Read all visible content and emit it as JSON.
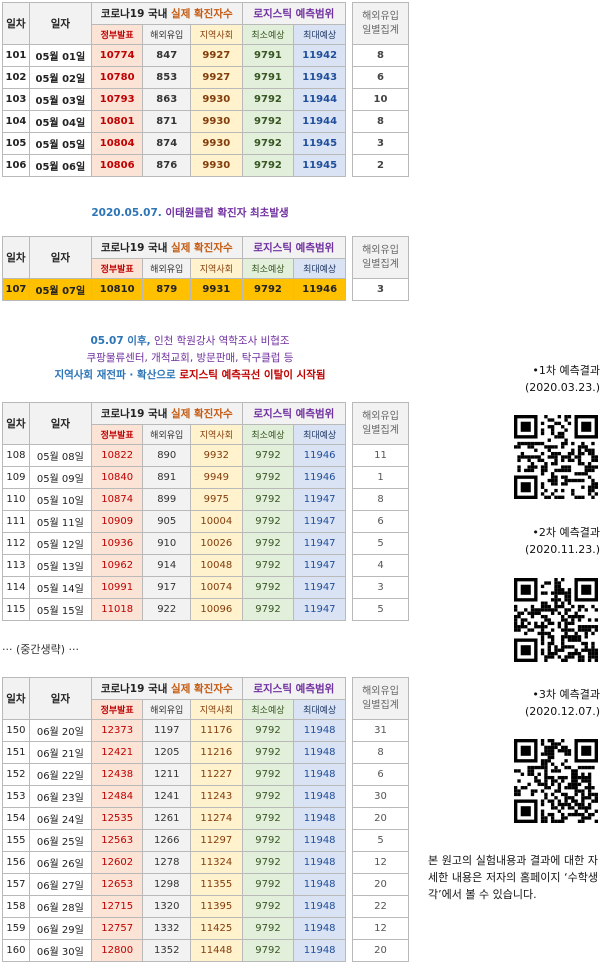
{
  "header": {
    "col_no": "일차",
    "col_date": "일자",
    "corona_title_a": "코로나19 국내 ",
    "corona_title_b": "실제 확진자수",
    "logistic_title_a": "로지스틱 ",
    "logistic_title_b": "예측범위",
    "sub_confirmed": "정부발표",
    "sub_overseas": "해외유입",
    "sub_local": "지역사회",
    "sub_min": "최소예상",
    "sub_max": "최대예상",
    "side_title_line1": "해외유입",
    "side_title_line2": "일별집계"
  },
  "table1": {
    "rows": [
      {
        "no": "101",
        "date": "05월 01일",
        "confirmed": "10774",
        "overseas": "847",
        "local": "9927",
        "min": "9791",
        "max": "11942",
        "daily": "8"
      },
      {
        "no": "102",
        "date": "05월 02일",
        "confirmed": "10780",
        "overseas": "853",
        "local": "9927",
        "min": "9791",
        "max": "11943",
        "daily": "6"
      },
      {
        "no": "103",
        "date": "05월 03일",
        "confirmed": "10793",
        "overseas": "863",
        "local": "9930",
        "min": "9792",
        "max": "11944",
        "daily": "10"
      },
      {
        "no": "104",
        "date": "05월 04일",
        "confirmed": "10801",
        "overseas": "871",
        "local": "9930",
        "min": "9792",
        "max": "11944",
        "daily": "8"
      },
      {
        "no": "105",
        "date": "05월 05일",
        "confirmed": "10804",
        "overseas": "874",
        "local": "9930",
        "min": "9792",
        "max": "11945",
        "daily": "3"
      },
      {
        "no": "106",
        "date": "05월 06일",
        "confirmed": "10806",
        "overseas": "876",
        "local": "9930",
        "min": "9792",
        "max": "11945",
        "daily": "2"
      }
    ]
  },
  "note1": {
    "date": "2020.05.07.",
    "text": " 이태원클럽 확진자 최초발생"
  },
  "table2": {
    "rows": [
      {
        "no": "107",
        "date": "05월 07일",
        "confirmed": "10810",
        "overseas": "879",
        "local": "9931",
        "min": "9792",
        "max": "11946",
        "daily": "3"
      }
    ]
  },
  "note2": {
    "line1_date": "05.07 이후,",
    "line1_rest": " 인천 학원강사 역학조사 비협조",
    "line2": "쿠팡물류센터, 개척교회, 방문판매, 탁구클럽 등",
    "line3_a": "지역사회 재전파 · 확산으로 ",
    "line3_b": "로지스틱 예측곡선 이탈이 시작됨"
  },
  "table3": {
    "rows": [
      {
        "no": "108",
        "date": "05월 08일",
        "confirmed": "10822",
        "overseas": "890",
        "local": "9932",
        "min": "9792",
        "max": "11946",
        "daily": "11"
      },
      {
        "no": "109",
        "date": "05월 09일",
        "confirmed": "10840",
        "overseas": "891",
        "local": "9949",
        "min": "9792",
        "max": "11946",
        "daily": "1"
      },
      {
        "no": "110",
        "date": "05월 10일",
        "confirmed": "10874",
        "overseas": "899",
        "local": "9975",
        "min": "9792",
        "max": "11947",
        "daily": "8"
      },
      {
        "no": "111",
        "date": "05월 11일",
        "confirmed": "10909",
        "overseas": "905",
        "local": "10004",
        "min": "9792",
        "max": "11947",
        "daily": "6"
      },
      {
        "no": "112",
        "date": "05월 12일",
        "confirmed": "10936",
        "overseas": "910",
        "local": "10026",
        "min": "9792",
        "max": "11947",
        "daily": "5"
      },
      {
        "no": "113",
        "date": "05월 13일",
        "confirmed": "10962",
        "overseas": "914",
        "local": "10048",
        "min": "9792",
        "max": "11947",
        "daily": "4"
      },
      {
        "no": "114",
        "date": "05월 14일",
        "confirmed": "10991",
        "overseas": "917",
        "local": "10074",
        "min": "9792",
        "max": "11947",
        "daily": "3"
      },
      {
        "no": "115",
        "date": "05월 15일",
        "confirmed": "11018",
        "overseas": "922",
        "local": "10096",
        "min": "9792",
        "max": "11947",
        "daily": "5"
      }
    ]
  },
  "ellipsis": "··· (중간생략) ···",
  "table4": {
    "rows": [
      {
        "no": "150",
        "date": "06월 20일",
        "confirmed": "12373",
        "overseas": "1197",
        "local": "11176",
        "min": "9792",
        "max": "11948",
        "daily": "31"
      },
      {
        "no": "151",
        "date": "06월 21일",
        "confirmed": "12421",
        "overseas": "1205",
        "local": "11216",
        "min": "9792",
        "max": "11948",
        "daily": "8"
      },
      {
        "no": "152",
        "date": "06월 22일",
        "confirmed": "12438",
        "overseas": "1211",
        "local": "11227",
        "min": "9792",
        "max": "11948",
        "daily": "6"
      },
      {
        "no": "153",
        "date": "06월 23일",
        "confirmed": "12484",
        "overseas": "1241",
        "local": "11243",
        "min": "9792",
        "max": "11948",
        "daily": "30"
      },
      {
        "no": "154",
        "date": "06월 24일",
        "confirmed": "12535",
        "overseas": "1261",
        "local": "11274",
        "min": "9792",
        "max": "11948",
        "daily": "20"
      },
      {
        "no": "155",
        "date": "06월 25일",
        "confirmed": "12563",
        "overseas": "1266",
        "local": "11297",
        "min": "9792",
        "max": "11948",
        "daily": "5"
      },
      {
        "no": "156",
        "date": "06월 26일",
        "confirmed": "12602",
        "overseas": "1278",
        "local": "11324",
        "min": "9792",
        "max": "11948",
        "daily": "12"
      },
      {
        "no": "157",
        "date": "06월 27일",
        "confirmed": "12653",
        "overseas": "1298",
        "local": "11355",
        "min": "9792",
        "max": "11948",
        "daily": "20"
      },
      {
        "no": "158",
        "date": "06월 28일",
        "confirmed": "12715",
        "overseas": "1320",
        "local": "11395",
        "min": "9792",
        "max": "11948",
        "daily": "22"
      },
      {
        "no": "159",
        "date": "06월 29일",
        "confirmed": "12757",
        "overseas": "1332",
        "local": "11425",
        "min": "9792",
        "max": "11948",
        "daily": "12"
      },
      {
        "no": "160",
        "date": "06월 30일",
        "confirmed": "12800",
        "overseas": "1352",
        "local": "11448",
        "min": "9792",
        "max": "11948",
        "daily": "20"
      }
    ]
  },
  "qr": [
    {
      "label": "•1차 예측결과",
      "date": "(2020.03.23.)",
      "icon": "qr-code-icon"
    },
    {
      "label": "•2차 예측결과",
      "date": "(2020.11.23.)",
      "icon": "qr-code-icon"
    },
    {
      "label": "•3차 예측결과",
      "date": "(2020.12.07.)",
      "icon": "qr-code-icon"
    }
  ],
  "description": "본 원고의 실험내용과 결과에 대한 자세한 내용은 저자의 홈페이지 ‘수학생각’에서 볼 수 있습니다.",
  "colors": {
    "red_cell": "#fbe3d6",
    "yellow_cell": "#fff2cc",
    "green_cell": "#e2efda",
    "blue_cell": "#dae3f3",
    "highlight": "#ffc000"
  }
}
